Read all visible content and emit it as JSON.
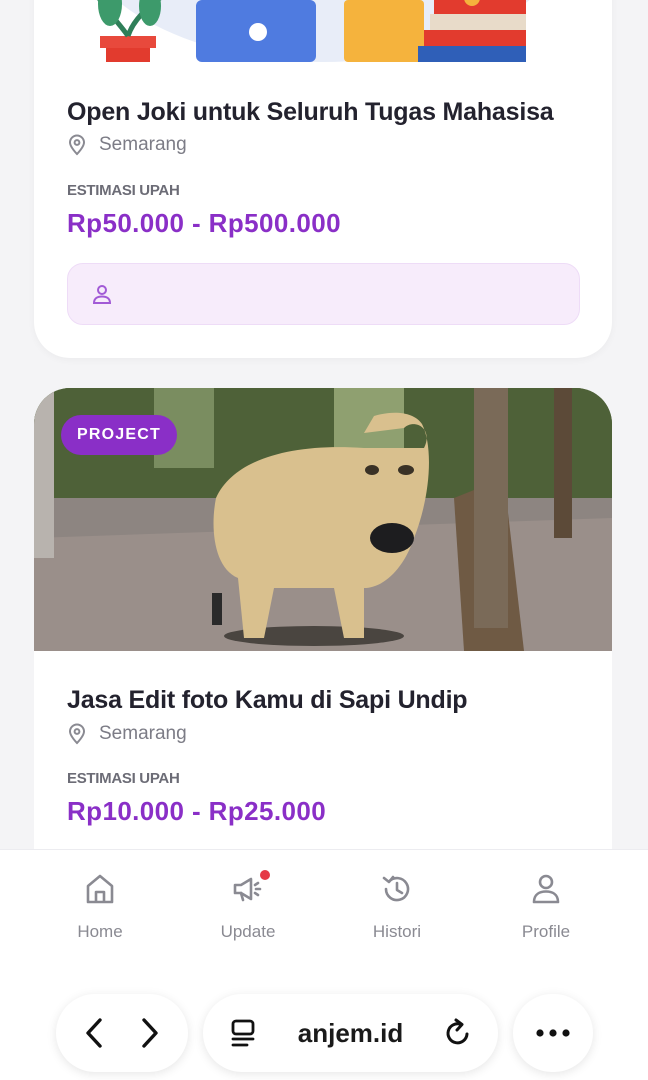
{
  "listings": [
    {
      "title": "Open Joki untuk Seluruh Tugas Mahasisa",
      "location": "Semarang",
      "wage_label": "ESTIMASI UPAH",
      "wage_range": "Rp50.000 - Rp500.000",
      "image_icon": "books-laptop-plant-illustration"
    },
    {
      "badge": "PROJECT",
      "title": "Jasa Edit foto Kamu di Sapi Undip",
      "location": "Semarang",
      "wage_label": "ESTIMASI UPAH",
      "wage_range": "Rp10.000 - Rp25.000",
      "image_icon": "cow-statue-photo"
    }
  ],
  "bottom_nav": {
    "items": [
      {
        "label": "Home",
        "icon": "home-icon"
      },
      {
        "label": "Update",
        "icon": "megaphone-icon",
        "has_notification": true
      },
      {
        "label": "Histori",
        "icon": "history-icon"
      },
      {
        "label": "Profile",
        "icon": "user-icon"
      }
    ]
  },
  "browser": {
    "url": "anjem.id",
    "icons": [
      "back-icon",
      "forward-icon",
      "tabs-icon",
      "reload-icon",
      "more-icon"
    ]
  },
  "colors": {
    "accent": "#8a2fc7",
    "poster_bg": "#f7ecfb",
    "notification": "#e53946",
    "page_bg": "#f4f4f6"
  }
}
